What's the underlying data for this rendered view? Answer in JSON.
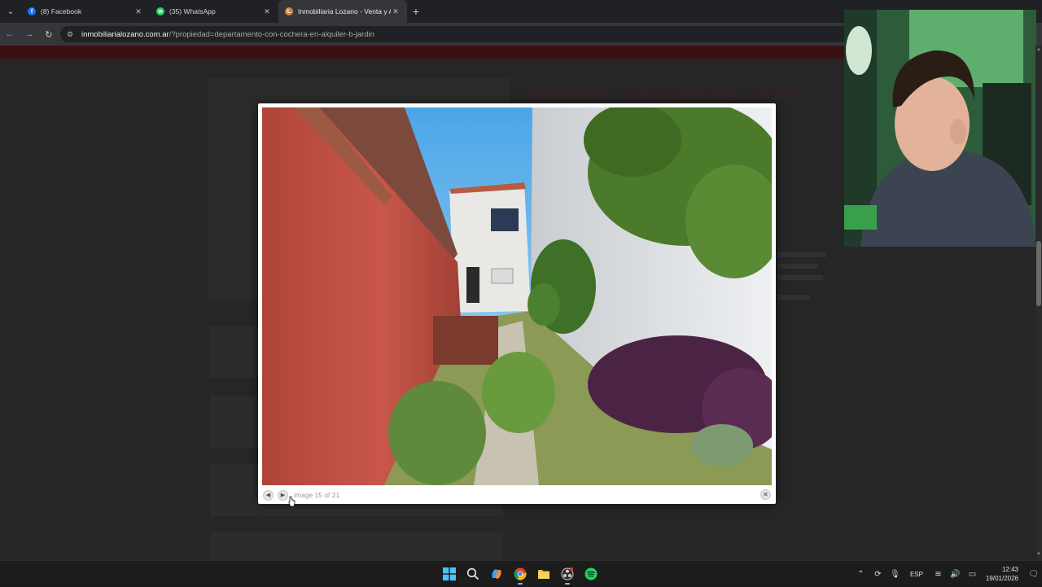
{
  "browser": {
    "tabs": [
      {
        "label": "(8) Facebook",
        "icon": "facebook-icon",
        "color": "#1877f2",
        "active": false
      },
      {
        "label": "(35) WhatsApp",
        "icon": "whatsapp-icon",
        "color": "#25d366",
        "active": false
      },
      {
        "label": "Inmobiliaria Lozano - Venta y A",
        "icon": "site-favicon-icon",
        "color": "#d9843a",
        "active": true
      }
    ],
    "url_host": "inmobiliarialozano.com.ar",
    "url_path": "/?propiedad=departamento-con-cochera-en-alquiler-b-jardin"
  },
  "page": {
    "title_dim": "DEPARTAMENTO CON COCHERA EN ALQUILER B°"
  },
  "lightbox": {
    "counter": "image 15 of 21",
    "current_image": 15,
    "total_images": 21,
    "prev_icon": "arrow-left-icon",
    "next_icon": "arrow-right-icon",
    "close_icon": "close-icon"
  },
  "taskbar": {
    "language": "ESP",
    "time": "12:43",
    "date": "19/01/2026",
    "apps": [
      "windows-start-icon",
      "search-icon",
      "copilot-icon",
      "chrome-icon",
      "file-explorer-icon",
      "obs-icon",
      "spotify-icon"
    ]
  },
  "colors": {
    "accent_red": "#3a1014",
    "chrome_bg": "#202124",
    "toolbar_bg": "#35363a"
  }
}
